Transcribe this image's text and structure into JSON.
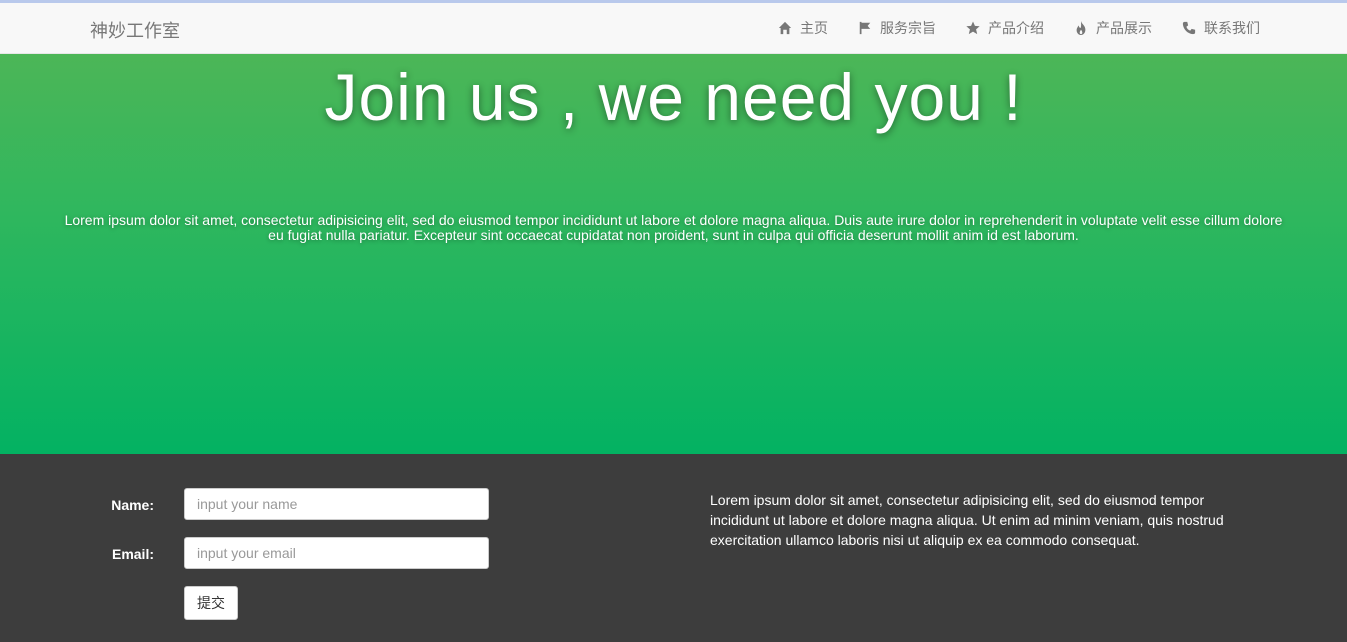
{
  "navbar": {
    "brand": "神妙工作室",
    "items": [
      {
        "label": "主页",
        "icon": "home-icon"
      },
      {
        "label": "服务宗旨",
        "icon": "flag-icon"
      },
      {
        "label": "产品介绍",
        "icon": "star-icon"
      },
      {
        "label": "产品展示",
        "icon": "fire-icon"
      },
      {
        "label": "联系我们",
        "icon": "phone-icon"
      }
    ]
  },
  "hero": {
    "title": "Join us , we need you !",
    "text": "Lorem ipsum dolor sit amet, consectetur adipisicing elit, sed do eiusmod tempor incididunt ut labore et dolore magna aliqua. Duis aute irure dolor in reprehenderit in voluptate velit esse cillum dolore eu fugiat nulla pariatur. Excepteur sint occaecat cupidatat non proident, sunt in culpa qui officia deserunt mollit anim id est laborum."
  },
  "form": {
    "name_label": "Name:",
    "name_placeholder": "input your name",
    "email_label": "Email:",
    "email_placeholder": "input your email",
    "submit_label": "提交"
  },
  "footer": {
    "text": "Lorem ipsum dolor sit amet, consectetur adipisicing elit, sed do eiusmod tempor incididunt ut labore et dolore magna aliqua. Ut enim ad minim veniam, quis nostrud exercitation ullamco laboris nisi ut aliquip ex ea commodo consequat."
  },
  "colors": {
    "hero_top": "#4cb657",
    "hero_bottom": "#03b262",
    "footer_bg": "#3d3d3d",
    "navbar_bg": "#f8f8f8"
  }
}
